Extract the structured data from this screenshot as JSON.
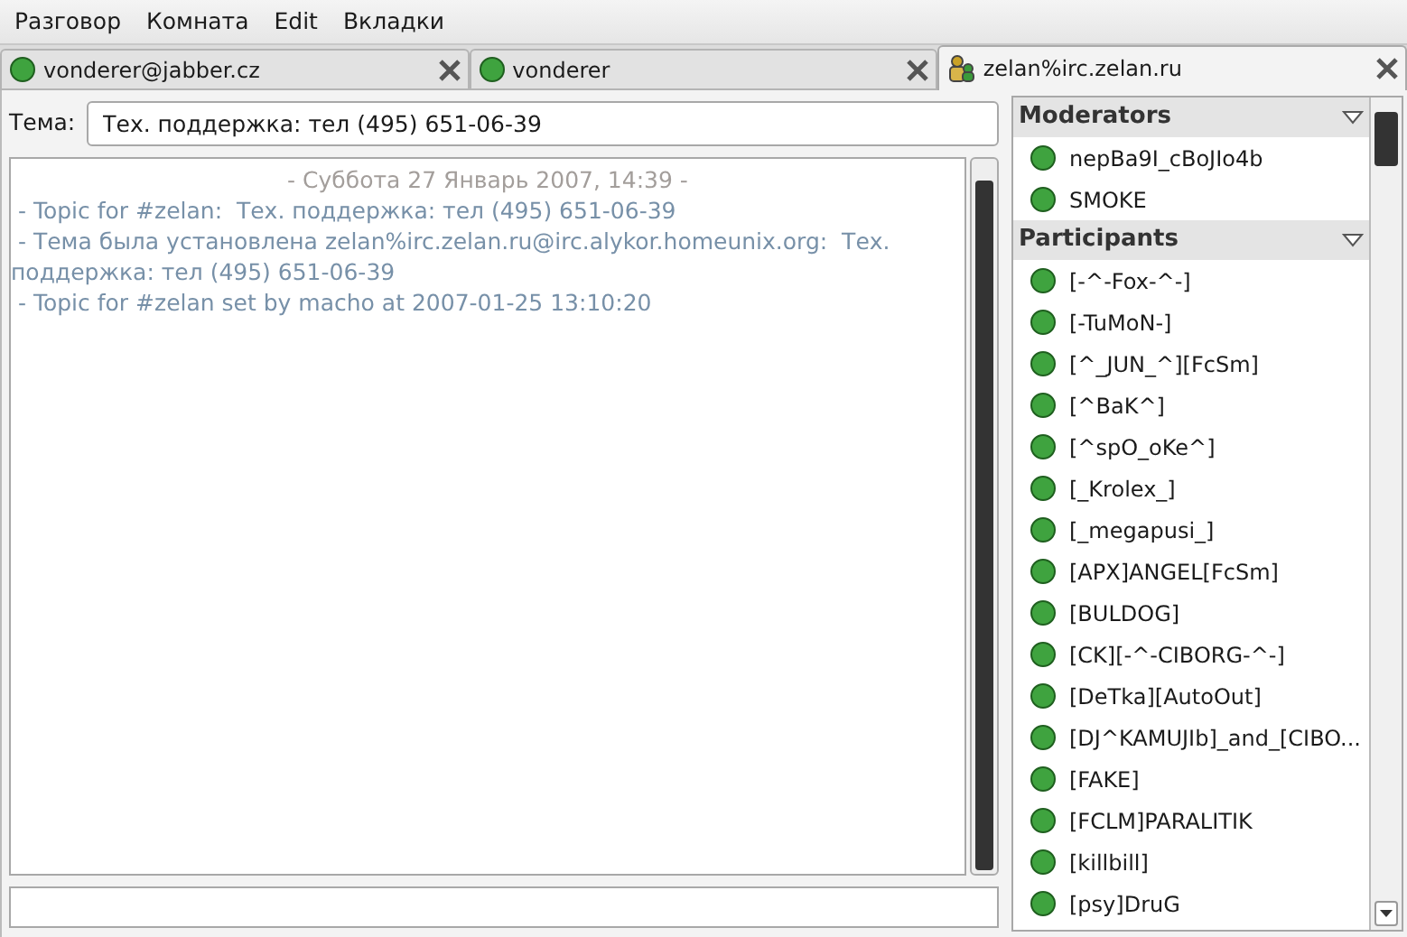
{
  "menu": [
    "Разговор",
    "Комната",
    "Edit",
    "Вкладки"
  ],
  "tabs": [
    {
      "label": "vonderer@jabber.cz",
      "kind": "contact",
      "selected": false
    },
    {
      "label": "vonderer",
      "kind": "contact",
      "selected": false
    },
    {
      "label": "zelan%irc.zelan.ru",
      "kind": "conference",
      "selected": true
    }
  ],
  "topic": {
    "label": "Тема:",
    "value": "Тех. поддержка: тел (495) 651-06-39"
  },
  "chat": [
    {
      "kind": "date",
      "text": "- Суббота 27 Январь 2007, 14:39 -"
    },
    {
      "kind": "system",
      "text": " - Topic for #zelan:  Тех. поддержка: тел (495) 651-06-39"
    },
    {
      "kind": "system",
      "text": " - Тема была установлена zelan%irc.zelan.ru@irc.alykor.homeunix.org:  Тех. поддержка: тел (495) 651-06-39"
    },
    {
      "kind": "system",
      "text": " - Topic for #zelan set by macho at 2007-01-25 13:10:20"
    }
  ],
  "roster": [
    {
      "group": "Moderators",
      "expanded": true,
      "members": [
        "nepBa9I_cBoJIo4b",
        "SMOKE"
      ]
    },
    {
      "group": "Participants",
      "expanded": true,
      "members": [
        "[-^-Fox-^-]",
        "[-TuMoN-]",
        "[^_JUN_^][FcSm]",
        "[^BaK^]",
        "[^spO_oKe^]",
        "[_Krolex_]",
        "[_megapusi_]",
        "[APX]ANGEL[FcSm]",
        "[BULDOG]",
        "[CK][-^-CIBORG-^-]",
        "[DeTka][AutoOut]",
        "[DJ^KAMUJIb]_and_[CIBO...",
        "[FAKE]",
        "[FCLM]PARALITIK",
        "[killbill]",
        "[psy]DruG"
      ]
    }
  ]
}
